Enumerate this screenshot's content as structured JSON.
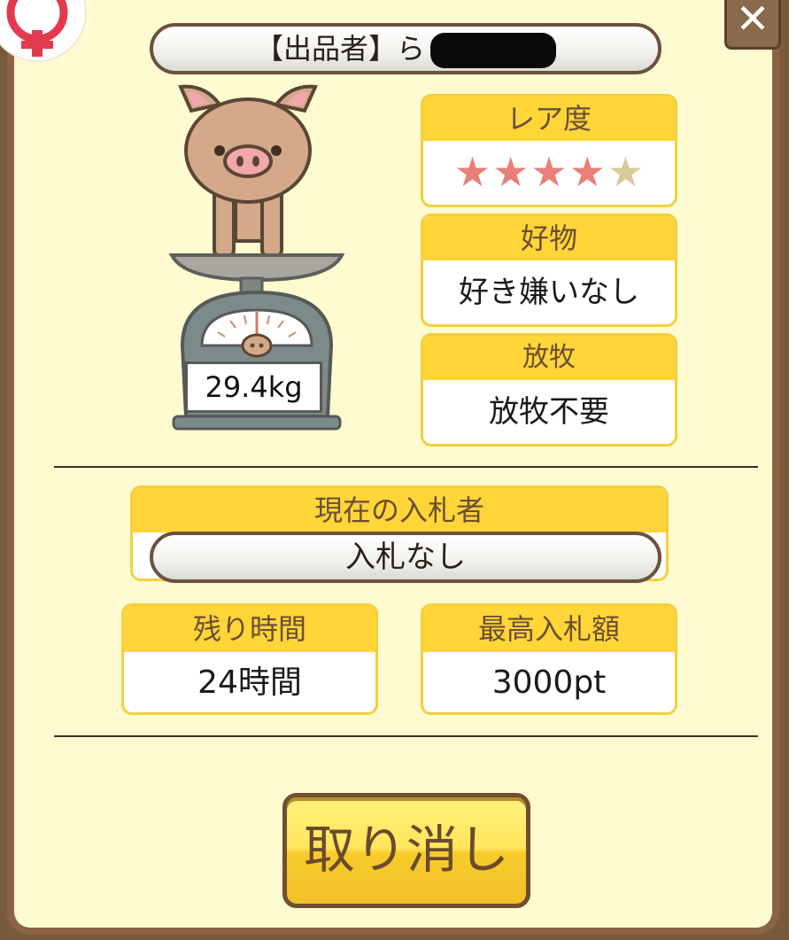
{
  "header": {
    "seller_label": "【出品者】ら",
    "close_glyph": "✕"
  },
  "pig": {
    "weight": "29.4kg"
  },
  "rarity": {
    "title": "レア度",
    "stars_total": 5,
    "stars_filled": 4,
    "star_glyph": "★",
    "filled_color": "#e88079",
    "empty_color": "#d9c99a"
  },
  "favorite": {
    "title": "好物",
    "value": "好き嫌いなし"
  },
  "grazing": {
    "title": "放牧",
    "value": "放牧不要"
  },
  "bidder": {
    "title": "現在の入札者",
    "value": "入札なし"
  },
  "time_left": {
    "title": "残り時間",
    "value": "24時間"
  },
  "highest_bid": {
    "title": "最高入札額",
    "value": "3000pt"
  },
  "actions": {
    "cancel_label": "取り消し"
  },
  "colors": {
    "panel_bg": "#fffbd0",
    "frame": "#8b6446",
    "header_yellow": "#ffd537",
    "header_text": "#6b4e36",
    "pig_body": "#d4a98a"
  }
}
